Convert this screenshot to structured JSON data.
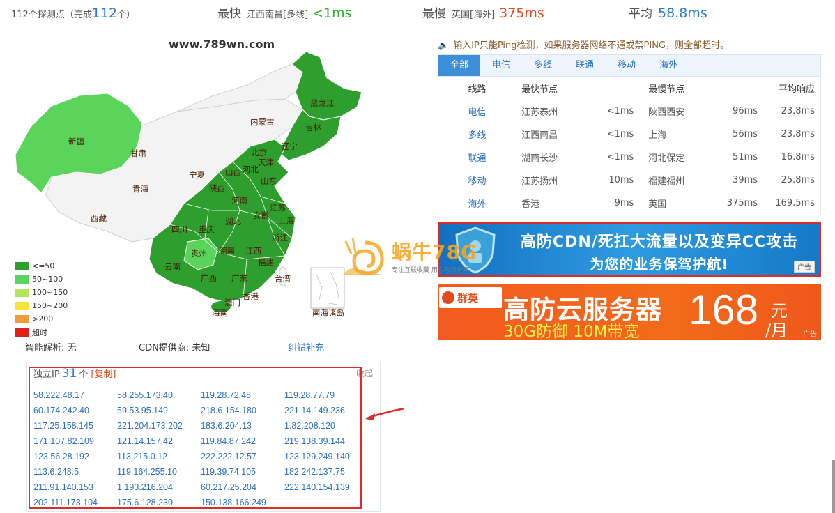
{
  "stats": {
    "count_prefix": "112个探测点（完成",
    "count_value": "112",
    "count_suffix": "个）",
    "fastest_label": "最快",
    "fastest_location": "江西南昌[多线]",
    "fastest_value": "<1ms",
    "slowest_label": "最慢",
    "slowest_location": "英国[海外]",
    "slowest_value": "375ms",
    "average_label": "平均",
    "average_value": "58.8ms"
  },
  "map": {
    "title": "www.789wn.com",
    "provinces": [
      "新疆",
      "甘肃",
      "青海",
      "西藏",
      "内蒙古",
      "黑龙江",
      "吉林",
      "辽宁",
      "北京",
      "天津",
      "河北",
      "山西",
      "宁夏",
      "陕西",
      "山东",
      "河南",
      "江苏",
      "安徽",
      "上海",
      "湖北",
      "四川",
      "重庆",
      "浙江",
      "贵州",
      "湖南",
      "江西",
      "福建",
      "云南",
      "广西",
      "广东",
      "台湾",
      "香港",
      "澳门",
      "海南",
      "南海诸岛"
    ],
    "legend": [
      {
        "label": "<=50",
        "color": "#2e9e2e"
      },
      {
        "label": "50~100",
        "color": "#5ad45a"
      },
      {
        "label": "100~150",
        "color": "#b5e65a"
      },
      {
        "label": "150~200",
        "color": "#f5e33a"
      },
      {
        "label": ">200",
        "color": "#f29a3a"
      },
      {
        "label": "超时",
        "color": "#e0211a"
      }
    ]
  },
  "info": {
    "dns": "智能解析: 无",
    "cdn": "CDN提供商: 未知",
    "report": "纠错补充"
  },
  "ip_panel": {
    "title": "独立IP",
    "count": "31",
    "unit": "个",
    "copy": "[复制]",
    "collapse": "收起",
    "ips": [
      "58.222.48.17",
      "58.255.173.40",
      "119.28.72.48",
      "119.28.77.79",
      "60.174.242.40",
      "59.53.95.149",
      "218.6.154.180",
      "221.14.149.236",
      "117.25.158.145",
      "221.204.173.202",
      "183.6.204.13",
      "1.82.208.120",
      "171.107.82.109",
      "121.14.157.42",
      "119.84.87.242",
      "219.138.39.144",
      "123.56.28.192",
      "113.215.0.12",
      "222.222.12.57",
      "123.129.249.140",
      "113.6.248.5",
      "119.164.255.10",
      "119.39.74.105",
      "182.242.137.75",
      "211.91.140.153",
      "1.193.216.204",
      "60.217.25.204",
      "222.140.154.139",
      "202.111.173.104",
      "175.6.128.230",
      "150.138.166.249"
    ]
  },
  "notice": "输入IP只能Ping检测，如果服务器网络不通或禁PING，则全部超时。",
  "tabs": [
    "全部",
    "电信",
    "多线",
    "联通",
    "移动",
    "海外"
  ],
  "table": {
    "headers": [
      "线路",
      "最快节点",
      "",
      "最慢节点",
      "",
      "平均响应"
    ],
    "rows": [
      {
        "line": "电信",
        "fast_node": "江苏泰州",
        "fast_ms": "<1ms",
        "slow_node": "陕西西安",
        "slow_ms": "96ms",
        "avg": "23.8ms"
      },
      {
        "line": "多线",
        "fast_node": "江西南昌",
        "fast_ms": "<1ms",
        "slow_node": "上海",
        "slow_ms": "56ms",
        "avg": "23.8ms"
      },
      {
        "line": "联通",
        "fast_node": "湖南长沙",
        "fast_ms": "<1ms",
        "slow_node": "河北保定",
        "slow_ms": "51ms",
        "avg": "16.8ms"
      },
      {
        "line": "移动",
        "fast_node": "江苏扬州",
        "fast_ms": "10ms",
        "slow_node": "福建福州",
        "slow_ms": "39ms",
        "avg": "25.8ms"
      },
      {
        "line": "海外",
        "fast_node": "香港",
        "fast_ms": "9ms",
        "slow_node": "英国",
        "slow_ms": "375ms",
        "avg": "169.5ms"
      }
    ]
  },
  "ad1": {
    "line1": "高防CDN/死扛大流量以及变异CC攻击",
    "line2": "为您的业务保驾护航!",
    "tag": "广告"
  },
  "ad2": {
    "brand": "群英",
    "line1": "高防云服务器",
    "line2": "30G防御 10M带宽",
    "price": "168",
    "unit_top": "元",
    "unit_bottom": "/月",
    "tag": "广告"
  },
  "watermark": {
    "text": "蜗牛78G",
    "sub": "专注互联收藏 用心与您分享"
  }
}
